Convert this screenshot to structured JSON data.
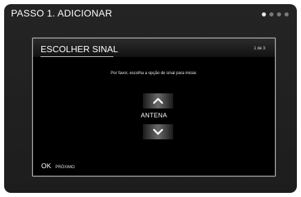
{
  "screen": {
    "step_title": "PASSO 1. ADICIONAR",
    "pager": {
      "total": 4,
      "active": 1
    }
  },
  "dialog": {
    "title": "ESCOLHER SINAL",
    "counter": "1 de 3",
    "instruction": "Por favor, escolha a opção de sinal para iniciar.",
    "selected_value": "ANTENA",
    "up_icon": "chevron-up-icon",
    "down_icon": "chevron-down-icon"
  },
  "footer": {
    "key": "OK",
    "action": "PRÓXIMO"
  },
  "colors": {
    "background": "#242424",
    "dialog": "#000000",
    "text": "#ffffff"
  }
}
